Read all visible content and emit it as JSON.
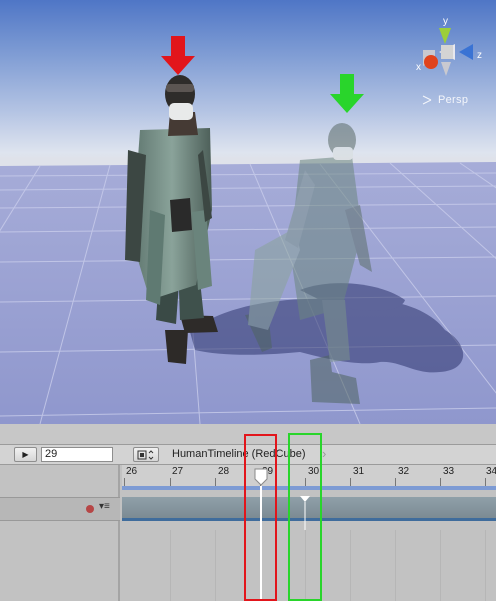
{
  "scene": {
    "gizmo": {
      "axis_y": "y",
      "axis_x": "x",
      "axis_z": "z",
      "projection_icon": "persp-lines-icon",
      "projection_label": "Persp"
    },
    "annotations": [
      {
        "name": "red-arrow-down",
        "color": "#e2151b"
      },
      {
        "name": "green-arrow-down",
        "color": "#29d52b"
      }
    ],
    "colors": {
      "sky_top": "#4f76c6",
      "ground": "#9fa6d4",
      "grid": "#c3c7e7"
    }
  },
  "timeline": {
    "play_icon": "play-frame-icon",
    "current_frame": "29",
    "clip_icon": "clip-select-icon",
    "title": "HumanTimeline (RedCube)",
    "ruler_ticks": [
      "26",
      "27",
      "28",
      "29",
      "30",
      "31",
      "32",
      "33",
      "34"
    ],
    "track": {
      "record_icon": "record-icon",
      "menu_icon": "track-menu-icon"
    },
    "colors": {
      "playhead": "#ffffff",
      "clip": "#84939b",
      "selection_red": "#e2151b",
      "selection_green": "#29d52b"
    }
  }
}
